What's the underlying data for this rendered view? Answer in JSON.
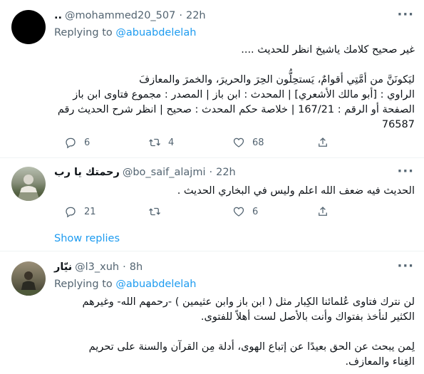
{
  "tweets": [
    {
      "display_name": "..",
      "handle": "@mohammed20_507",
      "time": "22h",
      "replying_label": "Replying to",
      "replying_to": "@abuabdelelah",
      "text": "غير صحيح كلامك ياشيخ انظر للحديث ....\n\nليَكونَنَّ من أمَّتِي أقوامٌ، يَستحِلُّون الحِرَ والحريرَ، والخمرَ والمعازفَ\nالراوي : [أبو مالك الأشعري] | المحدث : ابن باز | المصدر : مجموع فتاوى ابن باز\nالصفحة أو الرقم : 167/21 | خلاصة حكم المحدث : صحيح | انظر شرح الحديث رقم\n76587",
      "replies": "6",
      "retweets": "4",
      "likes": "68"
    },
    {
      "display_name": "رحمتك يا رب",
      "handle": "@bo_saif_alajmi",
      "time": "22h",
      "text": "الحديث فيه ضعف الله اعلم وليس في البخاري الحديث .",
      "replies": "21",
      "retweets": "",
      "likes": "6"
    },
    {
      "display_name": "نيّار",
      "handle": "@l3_xuh",
      "time": "8h",
      "replying_label": "Replying to",
      "replying_to": "@abuabdelelah",
      "text": "لن نترك فتاوى عُلمائنا الكِبار مثل ( ابن باز وابن عثيمين ) -رحمهم الله- وغيرهم\nالكثير لنأخذ بفتواك وأنت بالأصل لست أهلاً للفتوى.\n\nلِمن يبحث عن الحق بعيدًا عن إتباع الهوى، أدلة مِن القرآن والسنة على تحريم\nالغِناء والمعازف."
    }
  ],
  "show_replies": "Show replies",
  "more_icon": "···"
}
